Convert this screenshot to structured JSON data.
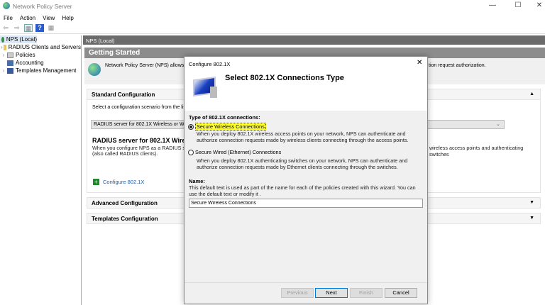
{
  "window": {
    "title": "Network Policy Server",
    "minimize": "—",
    "maximize": "☐",
    "close": "✕"
  },
  "menu": [
    "File",
    "Action",
    "View",
    "Help"
  ],
  "tree": {
    "root": "NPS (Local)",
    "items": [
      "RADIUS Clients and Servers",
      "Policies",
      "Accounting",
      "Templates Management"
    ]
  },
  "main": {
    "header": "NPS (Local)",
    "getting_started": "Getting Started",
    "intro": "Network Policy Server (NPS) allows you",
    "intro_tail": "tion request authorization.",
    "standard": {
      "title": "Standard Configuration",
      "select_text": "Select a configuration scenario from the list a",
      "dropdown": "RADIUS server for 802.1X Wireless or Wired",
      "heading": "RADIUS server for 802.1X Wireless",
      "desc1": "When you configure NPS as a RADIUS serv",
      "desc2": "(also called RADIUS clients).",
      "desc_tail": "wireless access points and authenticating switches",
      "link": "Configure 802.1X"
    },
    "advanced": "Advanced Configuration",
    "templates": "Templates Configuration"
  },
  "dialog": {
    "title": "Configure 802.1X",
    "heading": "Select 802.1X Connections Type",
    "type_label": "Type of 802.1X connections:",
    "options": [
      {
        "label": "Secure Wireless Connections",
        "selected": true,
        "desc": "When you deploy 802.1X wireless access points on your network, NPS can authenticate and authorize connection requests made by wireless clients connecting through the access points."
      },
      {
        "label": "Secure Wired (Ethernet) Connections",
        "selected": false,
        "desc": "When you deploy 802.1X authenticating switches on your network, NPS can authenticate and authorize connection requests made by Ethernet clients connecting through the switches."
      }
    ],
    "name_label": "Name:",
    "name_desc": "This default text is used as part of the name for each of the policies created with this wizard. You can use the default text or modify it .",
    "name_value": "Secure Wireless Connections",
    "buttons": {
      "previous": "Previous",
      "next": "Next",
      "finish": "Finish",
      "cancel": "Cancel"
    },
    "close": "✕"
  },
  "colors": {
    "highlight": "#ffff33",
    "link": "#1a5ea8"
  }
}
